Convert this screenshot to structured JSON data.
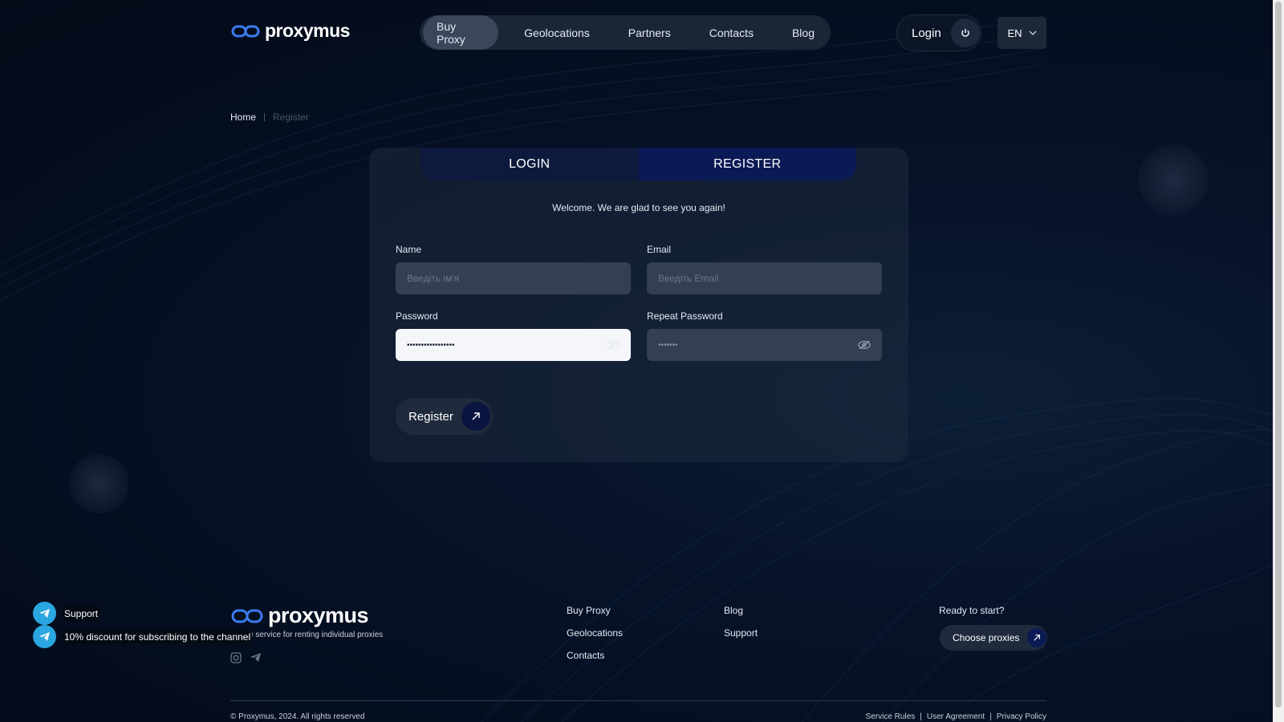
{
  "brand": {
    "name": "proxymus",
    "accent": "#0a1a55",
    "telegram_color": "#2aa6e0"
  },
  "header": {
    "nav": [
      {
        "label": "Buy Proxy",
        "active": true
      },
      {
        "label": "Geolocations",
        "active": false
      },
      {
        "label": "Partners",
        "active": false
      },
      {
        "label": "Contacts",
        "active": false
      },
      {
        "label": "Blog",
        "active": false
      }
    ],
    "login_label": "Login",
    "language": "EN"
  },
  "breadcrumb": {
    "home": "Home",
    "current": "Register"
  },
  "auth": {
    "tabs": {
      "login": "LOGIN",
      "register": "REGISTER",
      "active": "register"
    },
    "welcome": "Welcome. We are glad to see you again!",
    "name": {
      "label": "Name",
      "placeholder": "Введіть ім'я"
    },
    "email": {
      "label": "Email",
      "placeholder": "Введіть Email"
    },
    "password": {
      "label": "Password",
      "value": "•••••••••••••••••"
    },
    "repeat_password": {
      "label": "Repeat Password",
      "value": "•••••••"
    },
    "submit_label": "Register"
  },
  "footer": {
    "logo": "proxymus",
    "tagline": "e service for renting individual proxies",
    "col1": [
      "Buy Proxy",
      "Geolocations",
      "Contacts"
    ],
    "col2": [
      "Blog",
      "Support"
    ],
    "cta_title": "Ready to start?",
    "cta_button": "Choose proxies",
    "copyright": "© Proxymus, 2024. All rights reserved",
    "legal": [
      "Service Rules",
      "User Agreement",
      "Privacy Policy"
    ],
    "legal_sep": "|",
    "icons": [
      "instagram-icon",
      "telegram-icon"
    ]
  },
  "widgets": {
    "support": "Support",
    "discount": "10% discount for subscribing to the channel"
  }
}
